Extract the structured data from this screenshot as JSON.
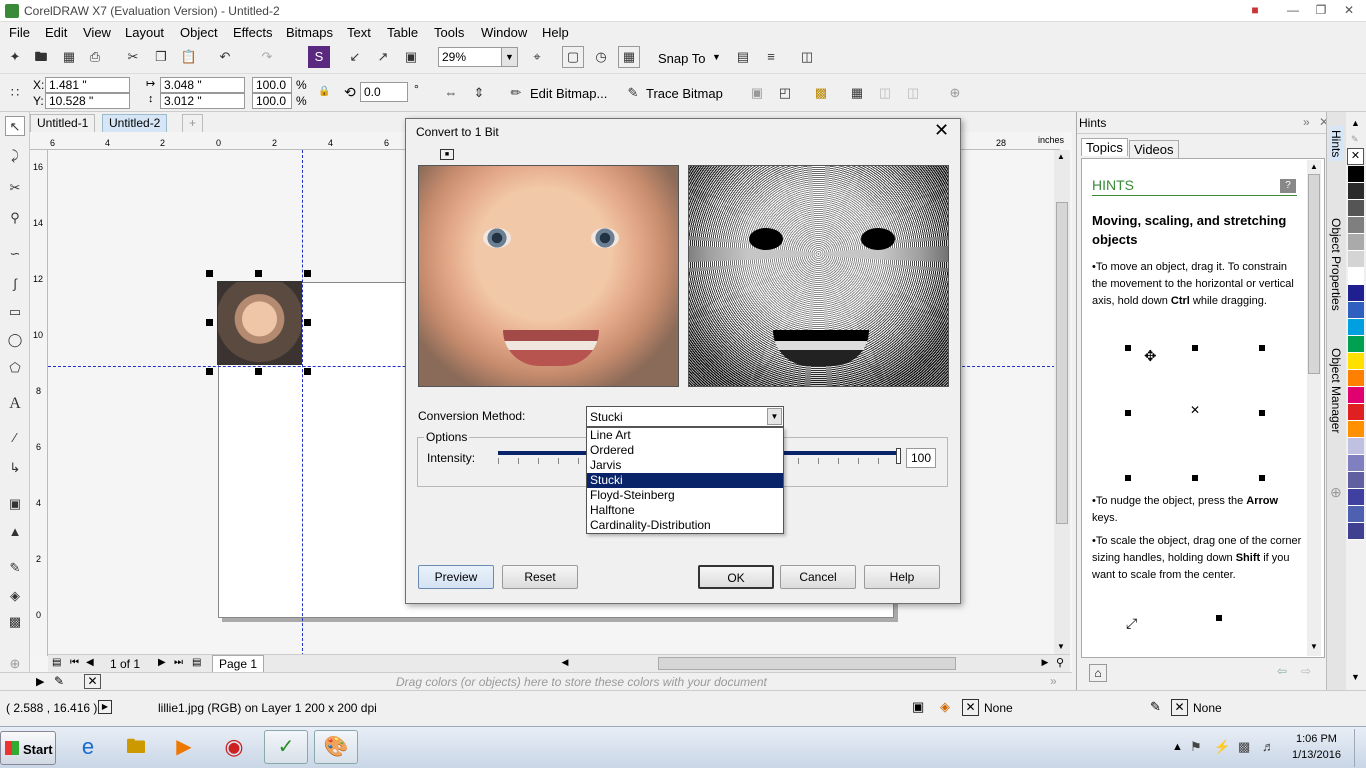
{
  "window": {
    "title": "CorelDRAW X7 (Evaluation Version) - Untitled-2"
  },
  "menu": [
    "File",
    "Edit",
    "View",
    "Layout",
    "Object",
    "Effects",
    "Bitmaps",
    "Text",
    "Table",
    "Tools",
    "Window",
    "Help"
  ],
  "toolbar": {
    "zoom": "29%",
    "snap_to": "Snap To"
  },
  "propbar": {
    "x": "1.481 \"",
    "y": "10.528 \"",
    "w": "3.048 \"",
    "h": "3.012 \"",
    "scale_w": "100.0",
    "scale_h": "100.0",
    "pct1": "%",
    "pct2": "%",
    "angle": "0.0",
    "deg": "°",
    "edit_bitmap": "Edit Bitmap...",
    "trace_bitmap": "Trace Bitmap",
    "x_label": "X:",
    "y_label": "Y:"
  },
  "doc_tabs": [
    "Untitled-1",
    "Untitled-2"
  ],
  "ruler": {
    "units": "inches",
    "top_ticks": [
      "6",
      "4",
      "2",
      "0",
      "2",
      "4",
      "6",
      "28"
    ],
    "left_ticks": [
      "16",
      "14",
      "12",
      "10",
      "8",
      "6",
      "4",
      "2",
      "0"
    ]
  },
  "page_nav": {
    "counter": "1 of 1",
    "page_tab": "Page 1"
  },
  "drag_hint": "Drag colors (or objects) here to store these colors with your document",
  "status": {
    "coords": "( 2.588 , 16.416 )",
    "info": "lillie1.jpg (RGB) on Layer 1 200 x 200 dpi",
    "fill": "None",
    "outline": "None"
  },
  "dialog": {
    "title": "Convert to 1 Bit",
    "conversion_label": "Conversion Method:",
    "selected_method": "Stucki",
    "methods": [
      "Line Art",
      "Ordered",
      "Jarvis",
      "Stucki",
      "Floyd-Steinberg",
      "Halftone",
      "Cardinality-Distribution"
    ],
    "options_label": "Options",
    "intensity_label": "Intensity:",
    "intensity_value": "100",
    "intensity": 100,
    "preview": "Preview",
    "reset": "Reset",
    "ok": "OK",
    "cancel": "Cancel",
    "help": "Help"
  },
  "hints": {
    "panel_title": "Hints",
    "tabs": [
      "Topics",
      "Videos"
    ],
    "header": "HINTS",
    "heading": "Moving, scaling, and stretching objects",
    "p1_a": "To move an object, drag it. To constrain the movement to the horizontal or vertical axis, hold down ",
    "p1_b": "Ctrl",
    "p1_c": " while dragging.",
    "p2_a": "To nudge the object, press the ",
    "p2_b": "Arrow",
    "p2_c": " keys.",
    "p3_a": "To scale the object, drag one of the corner sizing handles, holding down ",
    "p3_b": "Shift",
    "p3_c": " if you want to scale from the center."
  },
  "side_tabs": [
    "Hints",
    "Object Properties",
    "Object Manager"
  ],
  "palette_colors": [
    "#000000",
    "#2b2b2b",
    "#555555",
    "#7f7f7f",
    "#aaaaaa",
    "#d4d4d4",
    "#ffffff",
    "#1f1f8f",
    "#2f5fbf",
    "#00a0e0",
    "#00a050",
    "#ffe000",
    "#ff8000",
    "#e00070",
    "#e02020",
    "#ff9000",
    "#c0c0e0",
    "#8080c0",
    "#6060a0",
    "#4040a0",
    "#5060b0",
    "#404090"
  ],
  "taskbar": {
    "start": "Start",
    "time": "1:06 PM",
    "date": "1/13/2016"
  }
}
